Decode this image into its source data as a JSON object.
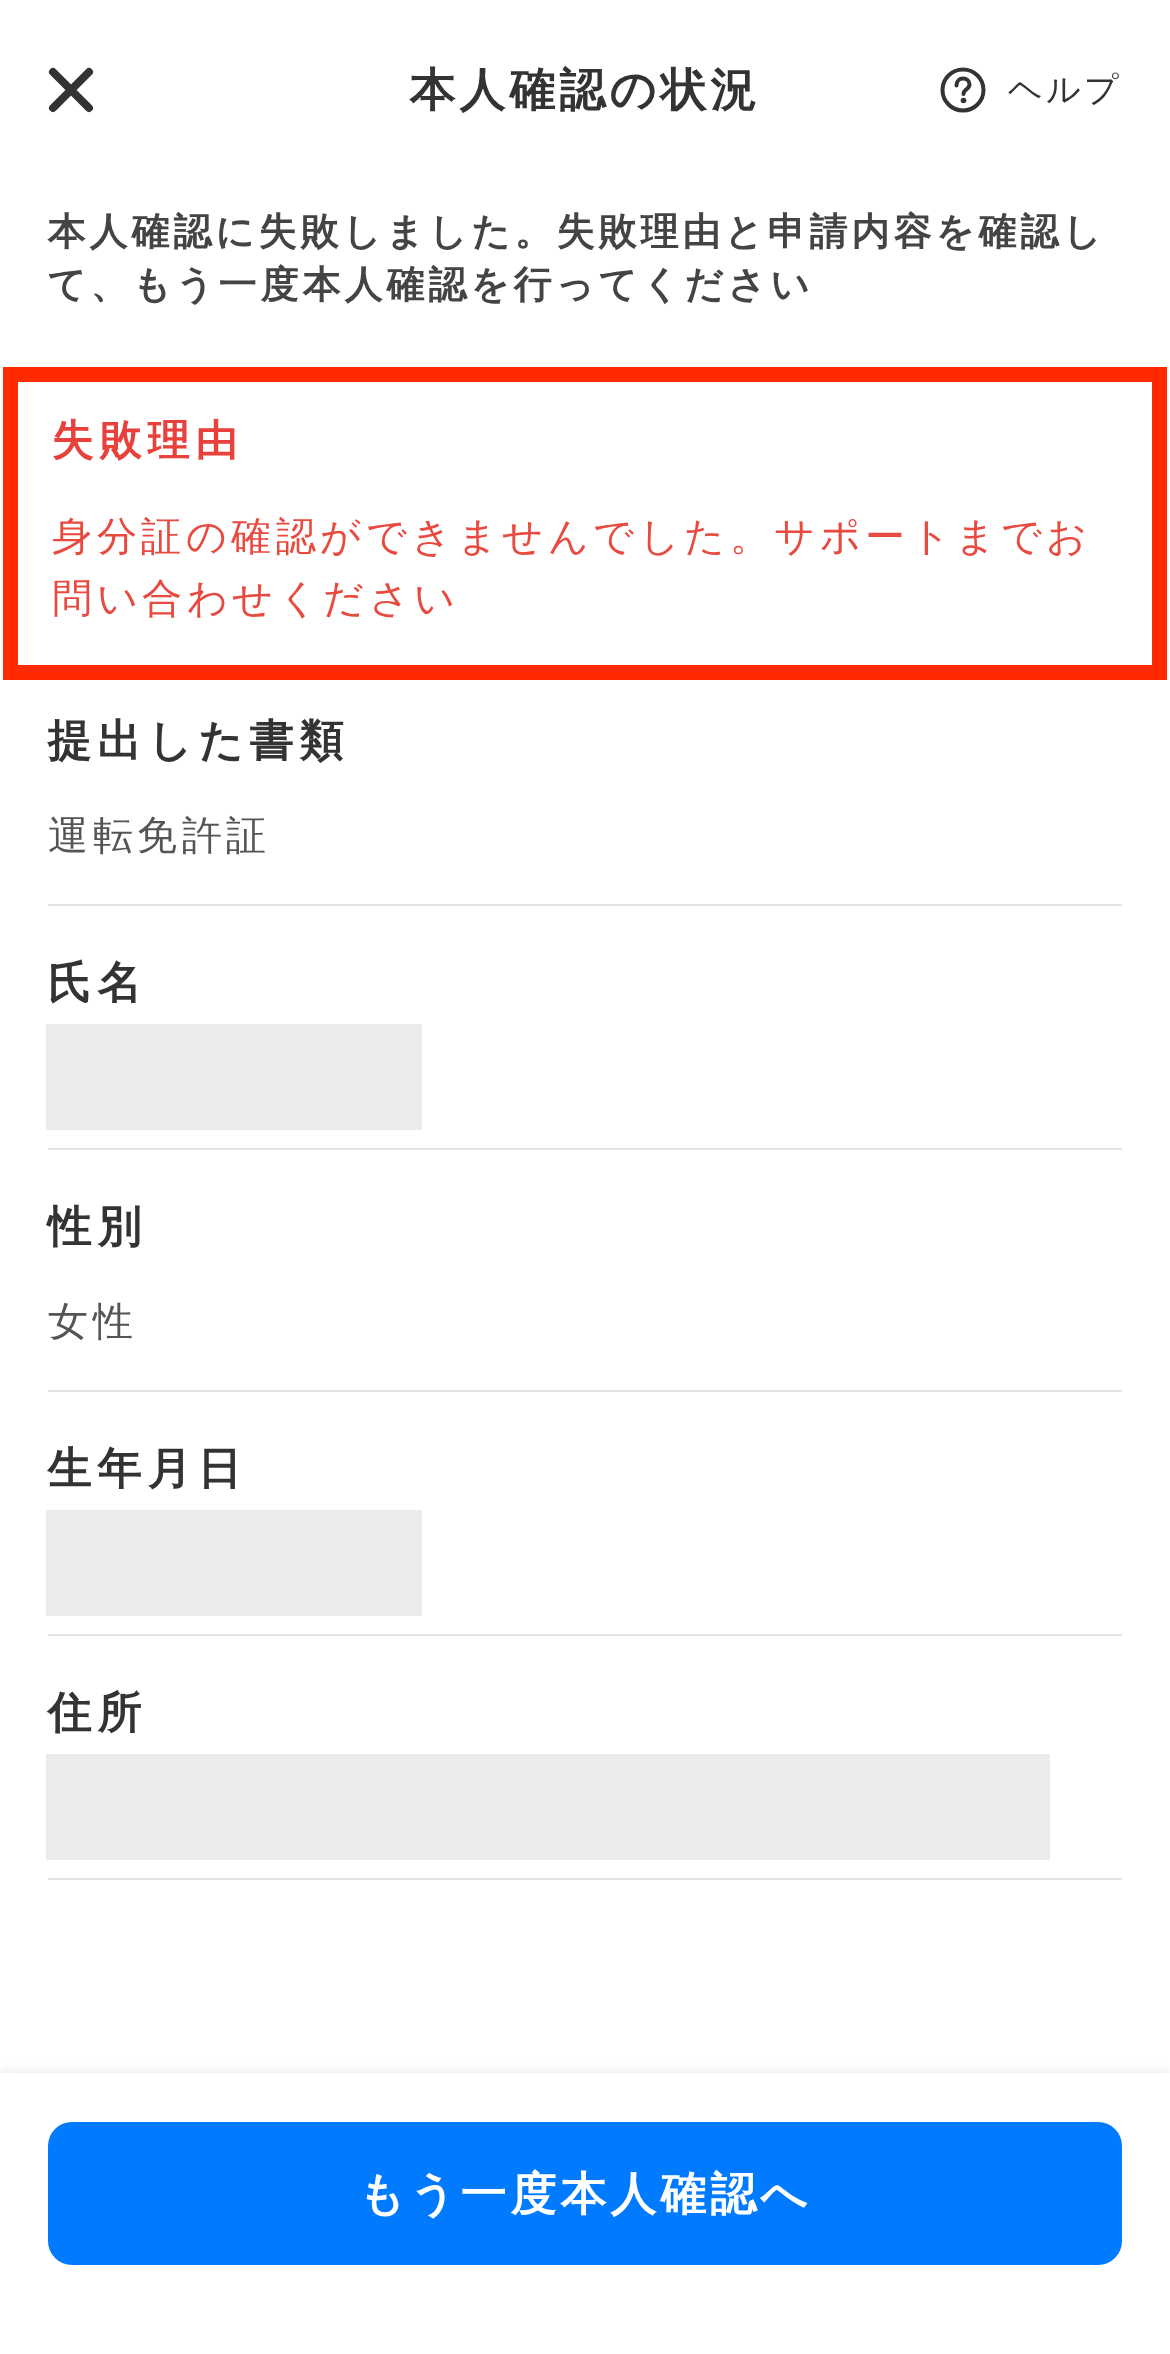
{
  "header": {
    "title": "本人確認の状況",
    "help_label": "ヘルプ"
  },
  "notice": "本人確認に失敗しました。失敗理由と申請内容を確認して、もう一度本人確認を行ってください",
  "failure": {
    "title": "失敗理由",
    "message": "身分証の確認ができませんでした。サポートまでお問い合わせください"
  },
  "fields": [
    {
      "label": "提出した書類",
      "kind": "text",
      "value": "運転免許証"
    },
    {
      "label": "氏名",
      "kind": "masked"
    },
    {
      "label": "性別",
      "kind": "text",
      "value": "女性"
    },
    {
      "label": "生年月日",
      "kind": "masked"
    },
    {
      "label": "住所",
      "kind": "masked_wide"
    }
  ],
  "footer": {
    "button": "もう一度本人確認へ"
  }
}
